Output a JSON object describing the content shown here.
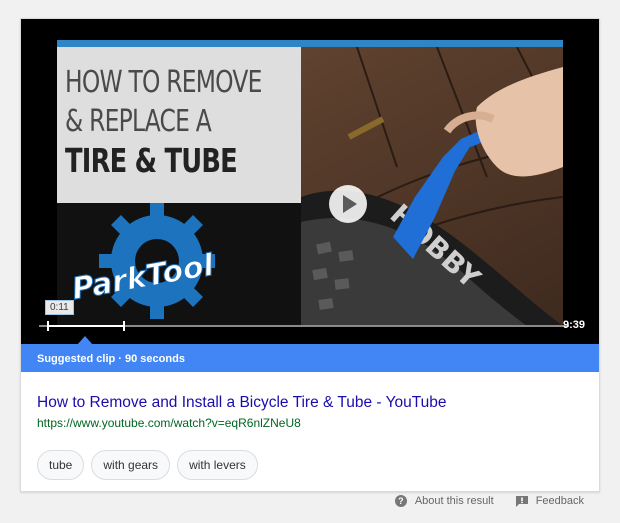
{
  "video": {
    "title_lines": [
      "HOW TO REMOVE",
      "& REPLACE A",
      "TIRE & TUBE"
    ],
    "logo_text": "ParkTool",
    "tire_text": "HOBBY",
    "current_time": "0:11",
    "duration": "9:39",
    "clip_progress": 0.02
  },
  "suggested_clip": {
    "label": "Suggested clip · 90 seconds"
  },
  "result": {
    "title": "How to Remove and Install a Bicycle Tire & Tube - YouTube",
    "url": "https://www.youtube.com/watch?v=eqR6nlZNeU8"
  },
  "chips": [
    "tube",
    "with gears",
    "with levers"
  ],
  "footer": {
    "about": "About this result",
    "feedback": "Feedback"
  },
  "colors": {
    "accent": "#4285f4",
    "link": "#1a0dab",
    "url": "#006621",
    "brand_blue": "#1e73be"
  },
  "icons": {
    "play": "play-icon",
    "about": "help-circle-icon",
    "feedback": "feedback-icon"
  }
}
